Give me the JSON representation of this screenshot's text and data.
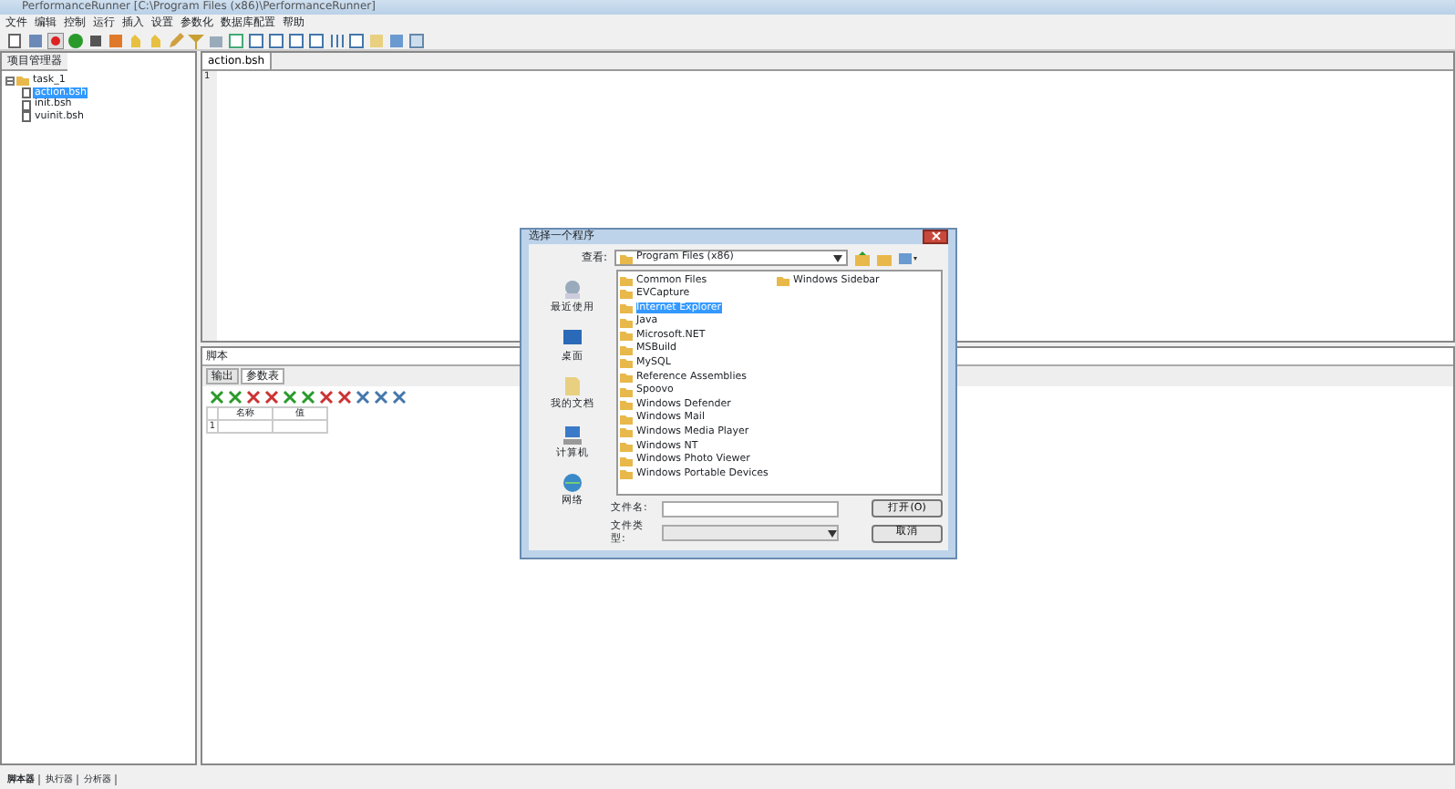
{
  "window": {
    "title": "PerformanceRunner  [C:\\Program Files (x86)\\PerformanceRunner]"
  },
  "menu": [
    "文件",
    "编辑",
    "控制",
    "运行",
    "插入",
    "设置",
    "参数化",
    "数据库配置",
    "帮助"
  ],
  "project_panel": {
    "tab": "项目管理器",
    "tree": [
      {
        "label": "task_1",
        "expanded": true,
        "selected": false,
        "children": [
          {
            "label": "action.bsh",
            "selected": true
          },
          {
            "label": "init.bsh",
            "selected": false
          },
          {
            "label": "vuinit.bsh",
            "selected": false
          }
        ]
      }
    ]
  },
  "editor": {
    "tabs": [
      {
        "label": "action.bsh",
        "selected": true
      }
    ],
    "line_numbers": [
      "1"
    ]
  },
  "script_label": "脚本",
  "bottom_tabs": [
    {
      "label": "输出",
      "selected": false
    },
    {
      "label": "参数表",
      "selected": true
    }
  ],
  "param_table": {
    "columns": [
      "名称",
      "值"
    ],
    "rows": [
      {
        "marker": "1",
        "cells": [
          "",
          ""
        ]
      }
    ]
  },
  "status_tabs": [
    {
      "label": "脚本器",
      "selected": true
    },
    {
      "label": "执行器",
      "selected": false
    },
    {
      "label": "分析器",
      "selected": false
    }
  ],
  "dialog": {
    "title": "选择一个程序",
    "look_in_label": "查看:",
    "look_in": "Program Files (x86)",
    "places": [
      {
        "label": "最近使用",
        "kind": "recent"
      },
      {
        "label": "桌面",
        "kind": "desktop"
      },
      {
        "label": "我的文档",
        "kind": "documents"
      },
      {
        "label": "计算机",
        "kind": "computer"
      },
      {
        "label": "网络",
        "kind": "network"
      }
    ],
    "files": [
      {
        "name": "Common Files",
        "selected": false
      },
      {
        "name": "EVCapture",
        "selected": false
      },
      {
        "name": "Internet Explorer",
        "selected": true
      },
      {
        "name": "Java",
        "selected": false
      },
      {
        "name": "Microsoft.NET",
        "selected": false
      },
      {
        "name": "MSBuild",
        "selected": false
      },
      {
        "name": "MySQL",
        "selected": false
      },
      {
        "name": "Reference Assemblies",
        "selected": false
      },
      {
        "name": "Spoovo",
        "selected": false
      },
      {
        "name": "Windows Defender",
        "selected": false
      },
      {
        "name": "Windows Mail",
        "selected": false
      },
      {
        "name": "Windows Media Player",
        "selected": false
      },
      {
        "name": "Windows NT",
        "selected": false
      },
      {
        "name": "Windows Photo Viewer",
        "selected": false
      },
      {
        "name": "Windows Portable Devices",
        "selected": false
      },
      {
        "name": "Windows Sidebar",
        "selected": false
      }
    ],
    "filename_label": "文件名:",
    "filetype_label": "文件类型:",
    "open_button": "打开(O)",
    "cancel_button": "取消"
  }
}
